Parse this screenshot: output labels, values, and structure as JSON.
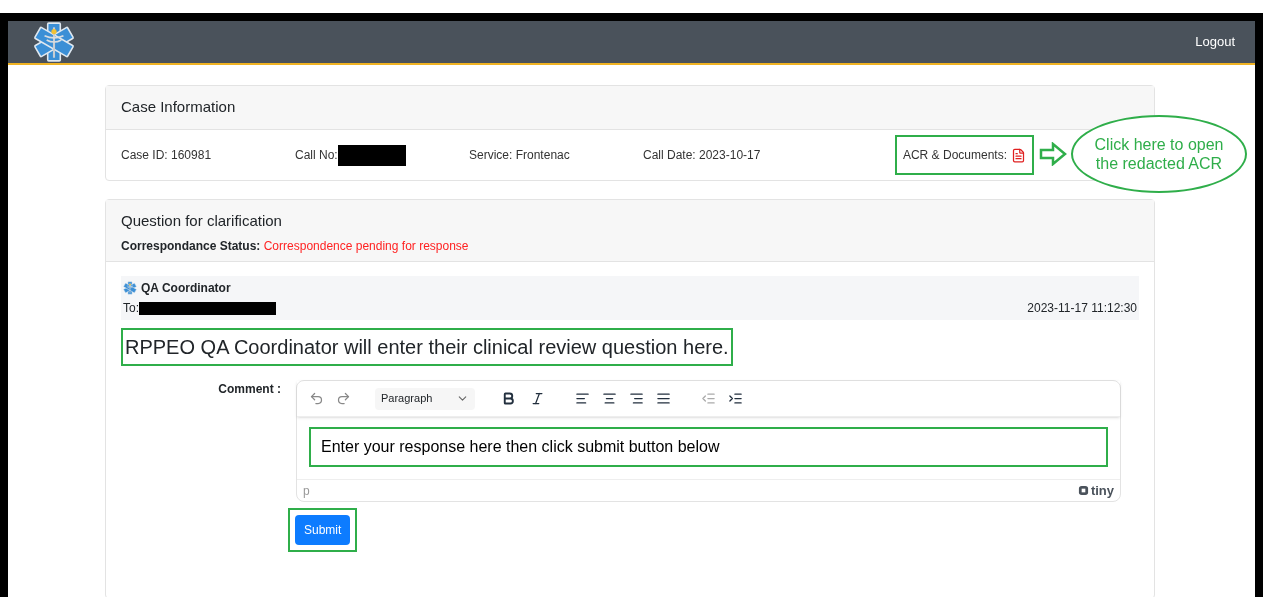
{
  "header": {
    "logout": "Logout"
  },
  "case_info": {
    "title": "Case Information",
    "fields": [
      {
        "label": "Case ID:",
        "value": "160981",
        "redacted": false
      },
      {
        "label": "Call No:",
        "redacted": true
      },
      {
        "label": "Service:",
        "value": "Frontenac",
        "redacted": false
      },
      {
        "label": "Call Date:",
        "value": "2023-10-17",
        "redacted": false
      }
    ],
    "documents_label": "ACR & Documents:",
    "callout": "Click here to open the redacted ACR"
  },
  "question": {
    "title": "Question for clarification",
    "status_label": "Correspondance Status:",
    "status_value": "Correspondence pending for response",
    "message": {
      "sender": "QA Coordinator",
      "to_label": "To:",
      "to_redacted": true,
      "date": "2023-11-17 11:12:30",
      "text": "RPPEO QA Coordinator will enter their clinical review question here."
    },
    "comment_label": "Comment :",
    "editor": {
      "block_format": "Paragraph",
      "content": "Enter your response here then click submit button below",
      "path": "p",
      "brand": "tiny"
    },
    "submit": "Submit"
  }
}
